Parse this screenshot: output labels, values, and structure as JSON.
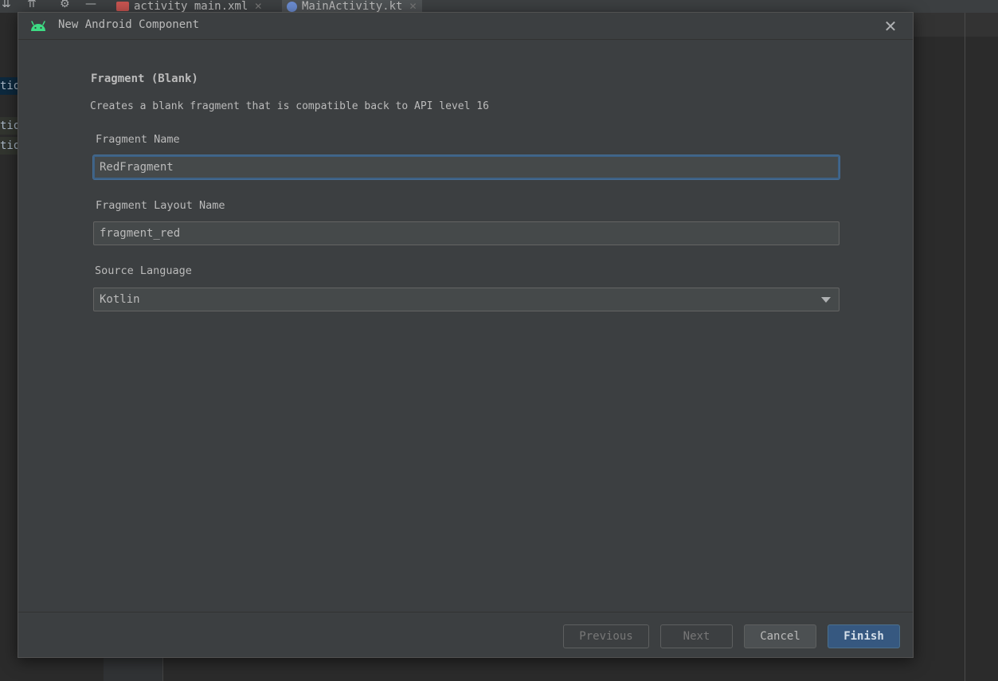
{
  "ide": {
    "tabs": [
      {
        "label": "activity_main.xml",
        "icon": "xml-file-icon",
        "color": "#c75450"
      },
      {
        "label": "MainActivity.kt",
        "icon": "kotlin-file-icon",
        "color": "#6b8cd1"
      }
    ],
    "background_fragments": [
      "tio",
      "tio",
      "tio"
    ]
  },
  "dialog": {
    "title": "New Android Component",
    "close_glyph": "✕",
    "heading": "Fragment (Blank)",
    "description": "Creates a blank fragment that is compatible back to API level 16",
    "fields": {
      "fragment_name": {
        "label": "Fragment Name",
        "value": "RedFragment"
      },
      "layout_name": {
        "label": "Fragment Layout Name",
        "value": "fragment_red"
      },
      "source_language": {
        "label": "Source Language",
        "value": "Kotlin"
      }
    },
    "buttons": {
      "previous": "Previous",
      "next": "Next",
      "cancel": "Cancel",
      "finish": "Finish"
    }
  },
  "colors": {
    "android_green": "#3ddc84",
    "focus_border": "#3d6185",
    "primary_button": "#365880"
  }
}
